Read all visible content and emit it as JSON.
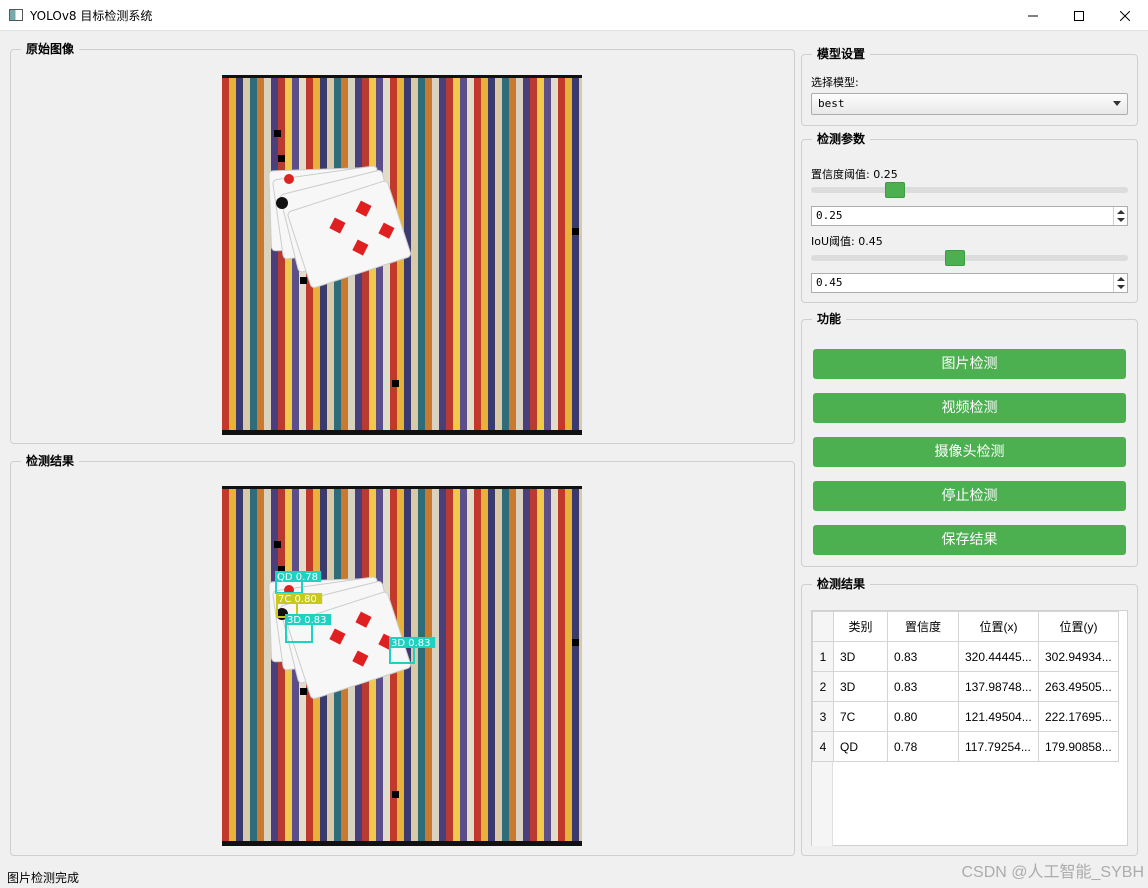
{
  "window": {
    "title": "YOLOv8 目标检测系统"
  },
  "panels": {
    "original_image_title": "原始图像",
    "result_image_title": "检测结果"
  },
  "model_settings": {
    "title": "模型设置",
    "select_label": "选择模型:",
    "selected_model": "best"
  },
  "detection_params": {
    "title": "检测参数",
    "conf_label": "置信度阈值: 0.25",
    "conf_value": "0.25",
    "iou_label": "IoU阈值: 0.45",
    "iou_value": "0.45"
  },
  "functions": {
    "title": "功能",
    "image_detect": "图片检测",
    "video_detect": "视频检测",
    "camera_detect": "摄像头检测",
    "stop_detect": "停止检测",
    "save_result": "保存结果"
  },
  "results": {
    "title": "检测结果",
    "headers": [
      "类别",
      "置信度",
      "位置(x)",
      "位置(y)"
    ],
    "rows": [
      {
        "index": "1",
        "cls": "3D",
        "conf": "0.83",
        "x": "320.44445...",
        "y": "302.94934..."
      },
      {
        "index": "2",
        "cls": "3D",
        "conf": "0.83",
        "x": "137.98748...",
        "y": "263.49505..."
      },
      {
        "index": "3",
        "cls": "7C",
        "conf": "0.80",
        "x": "121.49504...",
        "y": "222.17695..."
      },
      {
        "index": "4",
        "cls": "QD",
        "conf": "0.78",
        "x": "117.79254...",
        "y": "179.90858..."
      }
    ]
  },
  "detection_labels": [
    {
      "text": "QD 0.78",
      "color": "#1fd1c1"
    },
    {
      "text": "7C 0.80",
      "color": "#c8c81e"
    },
    {
      "text": "3D 0.83",
      "color": "#1fd1c1"
    },
    {
      "text": "3D 0.83",
      "color": "#1fd1c1"
    }
  ],
  "status": {
    "message": "图片检测完成"
  },
  "watermark": "CSDN @人工智能_SYBH",
  "colors": {
    "accent": "#4caf50"
  }
}
